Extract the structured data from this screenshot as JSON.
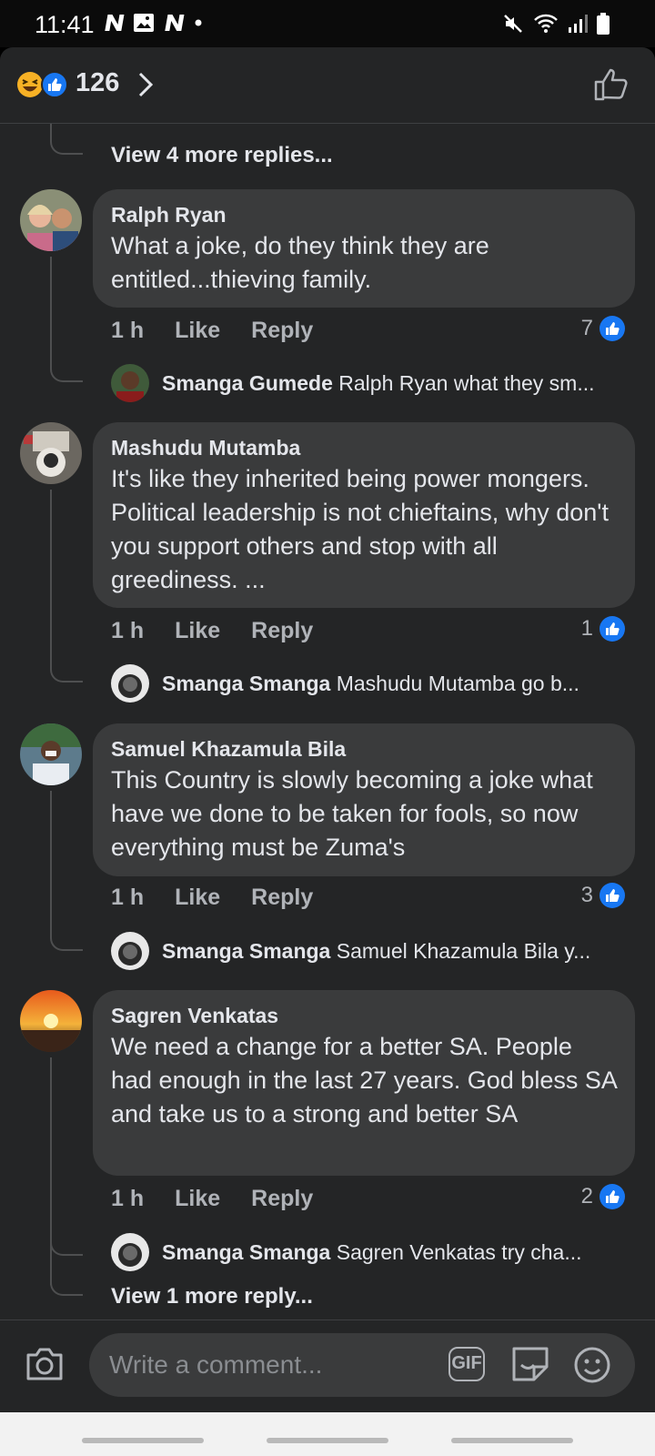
{
  "status": {
    "time": "11:41"
  },
  "header": {
    "reaction_count": "126"
  },
  "thread_top": {
    "view_more": "View 4 more replies..."
  },
  "comments": [
    {
      "name": "Ralph Ryan",
      "text": "What a joke, do they think they are entitled...thieving family.",
      "time": "1 h",
      "like": "Like",
      "reply": "Reply",
      "reacts": "7",
      "reply_preview": {
        "name": "Smanga Gumede",
        "text": "Ralph Ryan what they sm..."
      }
    },
    {
      "name": "Mashudu Mutamba",
      "text": "It's like they inherited being power mongers. Political leadership is not chieftains, why don't you support others and stop with all greediness. ...",
      "time": "1 h",
      "like": "Like",
      "reply": "Reply",
      "reacts": "1",
      "reply_preview": {
        "name": "Smanga Smanga",
        "text": "Mashudu Mutamba go b..."
      }
    },
    {
      "name": "Samuel Khazamula Bila",
      "text": "This Country  is slowly becoming a joke what have we done to be taken for fools, so now everything must be Zuma's",
      "time": "1 h",
      "like": "Like",
      "reply": "Reply",
      "reacts": "3",
      "reply_preview": {
        "name": "Smanga Smanga",
        "text": "Samuel Khazamula Bila y..."
      }
    },
    {
      "name": "Sagren Venkatas",
      "text": "We need a change for a better SA. People had enough in the last 27 years. God bless SA and take us to a strong and better SA",
      "time": "1 h",
      "like": "Like",
      "reply": "Reply",
      "reacts": "2",
      "reply_preview": {
        "name": "Smanga Smanga",
        "text": "Sagren Venkatas try cha..."
      },
      "view_more": "View 1 more reply..."
    }
  ],
  "composer": {
    "placeholder": "Write a comment...",
    "gif_label": "GIF"
  },
  "colors": {
    "background": "#242526",
    "bubble": "#3a3b3c",
    "like_blue": "#1877f2",
    "muted_text": "#b0b3b8"
  },
  "icons": [
    "haha-reaction-icon",
    "like-reaction-icon",
    "chevron-right-icon",
    "thumbs-up-icon",
    "camera-icon",
    "sticker-icon",
    "emoji-icon"
  ]
}
